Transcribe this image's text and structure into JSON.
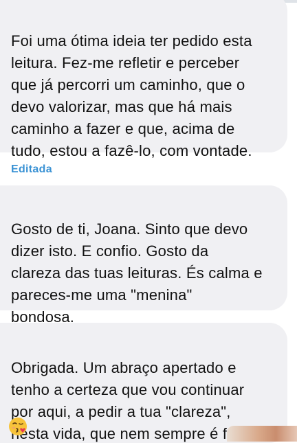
{
  "messages": [
    {
      "text": "Foi uma ótima ideia ter pedido esta\nleitura. Fez-me refletir e perceber\nque já percorri um caminho, que o\ndevo valorizar, mas que há mais\ncaminho a fazer e que, acima de\ntudo, estou a fazê-lo, com vontade."
    },
    {
      "text": "Gosto de ti, Joana. Sinto que devo\ndizer isto. E confio. Gosto da\nclareza das tuas leituras. És calma e\npareces-me uma \"menina\"\nbondosa."
    },
    {
      "text": "Obrigada. Um abraço apertado e\ntenho a certeza que vou continuar\npor aqui, a pedir a tua \"clareza\",\nnesta vida, que nem sempre é fácil."
    }
  ],
  "edited_label": "Editada",
  "emoji": "kissing-face-with-heart-icon",
  "colors": {
    "bubble_bg": "#f0f0f3",
    "text": "#111111",
    "edited": "#3a92d4"
  }
}
